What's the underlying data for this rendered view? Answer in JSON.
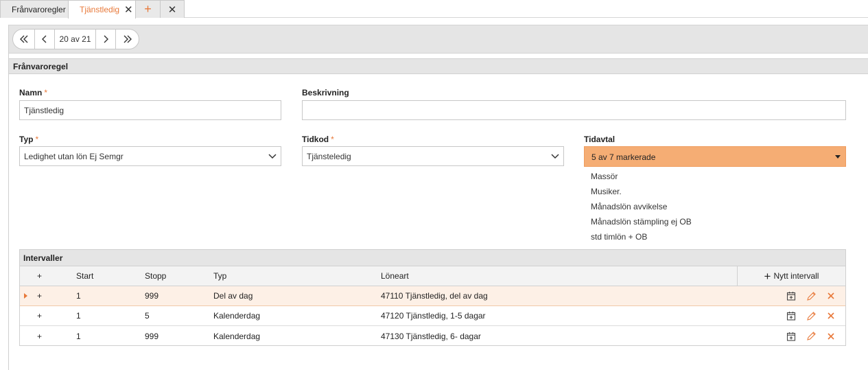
{
  "tabs": {
    "items": [
      {
        "label": "Frånvaroregler"
      },
      {
        "label": "Tjänstledig"
      }
    ],
    "add_glyph": "+",
    "close_glyph": "✕"
  },
  "pager": {
    "first": "«",
    "prev": "‹",
    "counter": "20 av 21",
    "next": "›",
    "last": "»"
  },
  "section": {
    "title": "Frånvaroregel"
  },
  "form": {
    "required_mark": "*",
    "name": {
      "label": "Namn",
      "value": "Tjänstledig"
    },
    "description": {
      "label": "Beskrivning",
      "value": ""
    },
    "type": {
      "label": "Typ",
      "value": "Ledighet utan lön Ej Semgr"
    },
    "timecode": {
      "label": "Tidkod",
      "value": "Tjänsteledig"
    },
    "agreement": {
      "label": "Tidavtal",
      "value": "5 av 7 markerade",
      "options": [
        "Massör",
        "Musiker.",
        "Månadslön avvikelse",
        "Månadslön stämpling ej OB",
        "std timlön + OB"
      ]
    }
  },
  "intervals": {
    "title": "Intervaller",
    "columns": {
      "expand": "+",
      "start": "Start",
      "stop": "Stopp",
      "type": "Typ",
      "wage": "Löneart"
    },
    "new_label": "Nytt intervall",
    "rows": [
      {
        "expand": "+",
        "start": "1",
        "stop": "999",
        "type": "Del av dag",
        "wage": "47110 Tjänstledig, del av dag",
        "selected": true
      },
      {
        "expand": "+",
        "start": "1",
        "stop": "5",
        "type": "Kalenderdag",
        "wage": "47120 Tjänstledig, 1-5 dagar",
        "selected": false
      },
      {
        "expand": "+",
        "start": "1",
        "stop": "999",
        "type": "Kalenderdag",
        "wage": "47130 Tjänstledig, 6- dagar",
        "selected": false
      }
    ]
  },
  "colors": {
    "accent": "#e8793a",
    "tidavtal_bg": "#f5ad74",
    "selected_row": "#fdf0e6",
    "band": "#e5e5e5"
  },
  "icons": [
    "close-icon",
    "plus-icon",
    "first-page-icon",
    "prev-page-icon",
    "next-page-icon",
    "last-page-icon",
    "chevron-down-icon",
    "caret-down-icon",
    "row-indicator-icon",
    "calendar-add-icon",
    "pencil-icon",
    "delete-icon"
  ]
}
